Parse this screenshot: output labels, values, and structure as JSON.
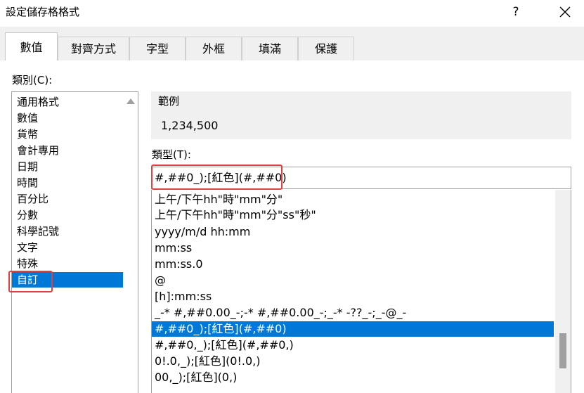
{
  "window": {
    "title": "設定儲存格格式",
    "help_label": "?"
  },
  "tabs": [
    "數值",
    "對齊方式",
    "字型",
    "外框",
    "填滿",
    "保護"
  ],
  "category": {
    "label": "類別(C):",
    "items": [
      "通用格式",
      "數值",
      "貨幣",
      "會計專用",
      "日期",
      "時間",
      "百分比",
      "分數",
      "科學記號",
      "文字",
      "特殊",
      "自訂"
    ],
    "selected_index": 11
  },
  "sample": {
    "label": "範例",
    "value": "1,234,500"
  },
  "type": {
    "label": "類型(T):",
    "value": "#,##0_);[紅色](#,##0)"
  },
  "format_list": {
    "items": [
      "上午/下午hh\"時\"mm\"分\"",
      "上午/下午hh\"時\"mm\"分\"ss\"秒\"",
      "yyyy/m/d hh:mm",
      "mm:ss",
      "mm:ss.0",
      "@",
      "[h]:mm:ss",
      "_-* #,##0.00_-;-* #,##0.00_-;_-* -??_-;_-@_-",
      "#,##0_);[紅色](#,##0)",
      "#,##0,_);[紅色](#,##0,)",
      "0!.0,_);[紅色](0!.0,)",
      "00,_);[紅色](0,)"
    ],
    "selected_index": 8,
    "scroll_fraction": 0.85
  },
  "colors": {
    "selection": "#0078d7",
    "highlight_border": "#e04040",
    "tab_bg": "#f0f0f0"
  },
  "icons": {
    "close": "close-icon",
    "scroll_up": "chevron-up-icon"
  }
}
